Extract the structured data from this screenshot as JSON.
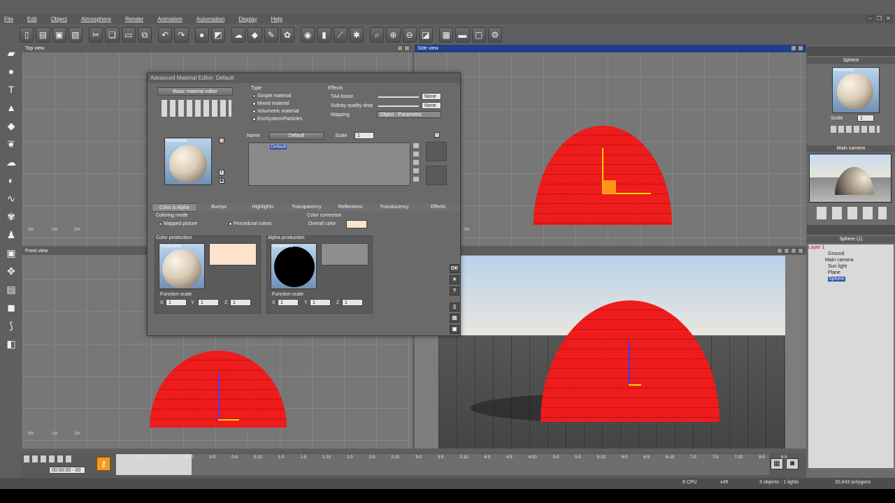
{
  "menu": [
    "File",
    "Edit",
    "Object",
    "Atmosphere",
    "Render",
    "Animation",
    "Automation",
    "Display",
    "Help"
  ],
  "viewports": {
    "top": "Top view",
    "side": "Side view",
    "front": "Front view"
  },
  "ruler_labels": [
    "0m",
    "1m",
    "2m"
  ],
  "editor": {
    "title": "Advanced Material Editor: Default",
    "basic_button": "Basic material editor",
    "preview_label": "Parametric",
    "type_header": "Type",
    "types": [
      "Simple material",
      "Mixed material",
      "Volumetric material",
      "EcoSystem/Particles"
    ],
    "effects_header": "Effects",
    "taa_label": "TAA boost",
    "taa_value": "None",
    "subray_label": "Subray quality drop",
    "subray_value": "None",
    "mapping_label": "Mapping",
    "mapping_value": "Object - Parametric",
    "name_label": "Name",
    "name_value": "Default",
    "scale_label": "Scale",
    "scale_value": "1",
    "tree_item": "Default",
    "tabs": [
      "Color & Alpha",
      "Bumps",
      "Highlights",
      "Transparency",
      "Reflections",
      "Translucency",
      "Effects"
    ],
    "coloring_mode_header": "Coloring mode",
    "mapped_picture": "Mapped picture",
    "procedural_colors": "Procedural colors",
    "color_correction_header": "Color correction",
    "overall_color": "Overall color",
    "color_production": "Color production",
    "alpha_production": "Alpha production",
    "function_scale": "Function scale",
    "axis_x": "X",
    "axis_y": "Y",
    "axis_z": "Z",
    "scale_one": "1",
    "ok": "OK"
  },
  "right_panel": {
    "object_name": "Sphere",
    "scale_label": "Scale",
    "scale_value": "1",
    "camera_title": "Main camera",
    "scene_title": "Sphere (1)",
    "tree": [
      "Layer 1",
      "Ground",
      "Main camera",
      "Sun light",
      "Plane",
      "Sphere"
    ]
  },
  "timeline": {
    "time": "00:00:00 - 00",
    "ticks": [
      "-1.0",
      "-1.5",
      "-1-10",
      "0-0",
      "0-5",
      "0-10",
      "1-0",
      "1-5",
      "1-10",
      "2-0",
      "2-5",
      "2-10",
      "3-0",
      "3-5",
      "3-10",
      "4-0",
      "4-5",
      "4-10",
      "5-0",
      "5-5",
      "5-10",
      "6-0",
      "6-5",
      "6-10",
      "7-0",
      "7-5",
      "7-10",
      "8-0",
      "8-5"
    ]
  },
  "status": {
    "cpu": "8 CPU",
    "zoom": "x49",
    "objects": "3 objects - 1 lights",
    "polygons": "20,643 polygons"
  },
  "colors": {
    "sphere": "#ee1c1c",
    "overall_color": "#fde2cc",
    "active_title": "#1f3f8a"
  }
}
